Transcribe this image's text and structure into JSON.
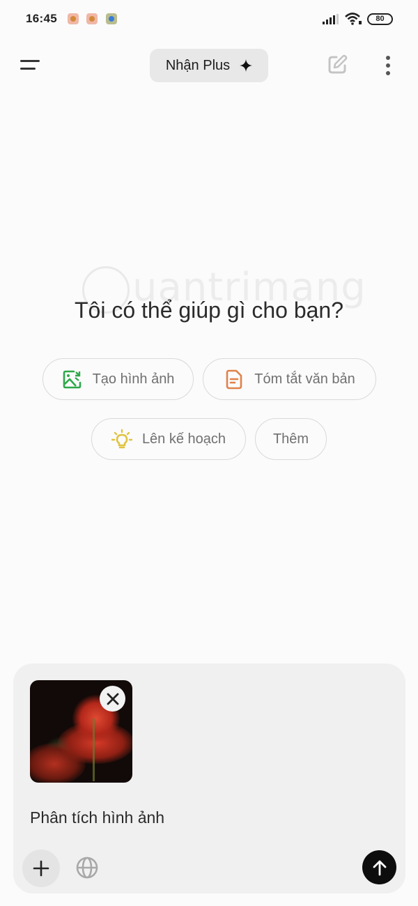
{
  "status_bar": {
    "time": "16:45",
    "notifications": [
      "app-notification-icon",
      "app-notification-icon",
      "app-notification-icon"
    ],
    "battery_level": "80"
  },
  "top_bar": {
    "menu_icon": "menu-icon",
    "upgrade_label": "Nhận Plus",
    "upgrade_icon": "sparkle-icon",
    "new_chat_icon": "edit-icon",
    "more_icon": "more-vertical-icon"
  },
  "watermark": "uantrimang",
  "main": {
    "headline": "Tôi có thể giúp gì cho bạn?",
    "suggestions": [
      {
        "label": "Tạo hình ảnh",
        "icon": "image-create-icon",
        "color": "#2ea84a"
      },
      {
        "label": "Tóm tắt văn bản",
        "icon": "document-icon",
        "color": "#e0824a"
      },
      {
        "label": "Lên kế hoạch",
        "icon": "lightbulb-icon",
        "color": "#e0c340"
      },
      {
        "label": "Thêm",
        "icon": null,
        "color": null
      }
    ]
  },
  "composer": {
    "attachment": {
      "type": "image",
      "description": "red spider lily flowers on dark background"
    },
    "input_value": "Phân tích hình ảnh",
    "add_icon": "plus-icon",
    "search_icon": "globe-icon",
    "send_icon": "arrow-up-icon"
  }
}
